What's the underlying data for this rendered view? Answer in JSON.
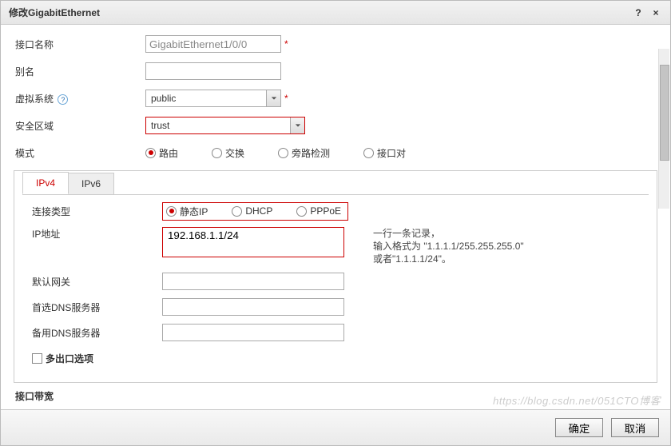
{
  "dialog": {
    "title": "修改GigabitEthernet",
    "help": "?",
    "close": "×"
  },
  "labels": {
    "interfaceName": "接口名称",
    "alias": "别名",
    "vsys": "虚拟系统",
    "zone": "安全区域",
    "mode": "模式",
    "connType": "连接类型",
    "ipaddr": "IP地址",
    "gateway": "默认网关",
    "dns1": "首选DNS服务器",
    "dns2": "备用DNS服务器",
    "multiExit": "多出口选项",
    "bandwidth": "接口带宽"
  },
  "values": {
    "interfaceName": "GigabitEthernet1/0/0",
    "vsys": "public",
    "zone": "trust",
    "alias": "",
    "gateway": "",
    "dns1": "",
    "dns2": "",
    "ipaddr": "192.168.1.1/24"
  },
  "modeOptions": [
    "路由",
    "交换",
    "旁路检测",
    "接口对"
  ],
  "modeSelected": 0,
  "tabs": [
    "IPv4",
    "IPv6"
  ],
  "activeTab": 0,
  "connOptions": [
    "静态IP",
    "DHCP",
    "PPPoE"
  ],
  "connSelected": 0,
  "hint": {
    "l1": "一行一条记录，",
    "l2": "输入格式为 \"1.1.1.1/255.255.255.0\"",
    "l3": "或者\"1.1.1.1/24\"。"
  },
  "footer": {
    "ok": "确定",
    "cancel": "取消"
  },
  "watermark": "https://blog.csdn.net/051CTO博客"
}
